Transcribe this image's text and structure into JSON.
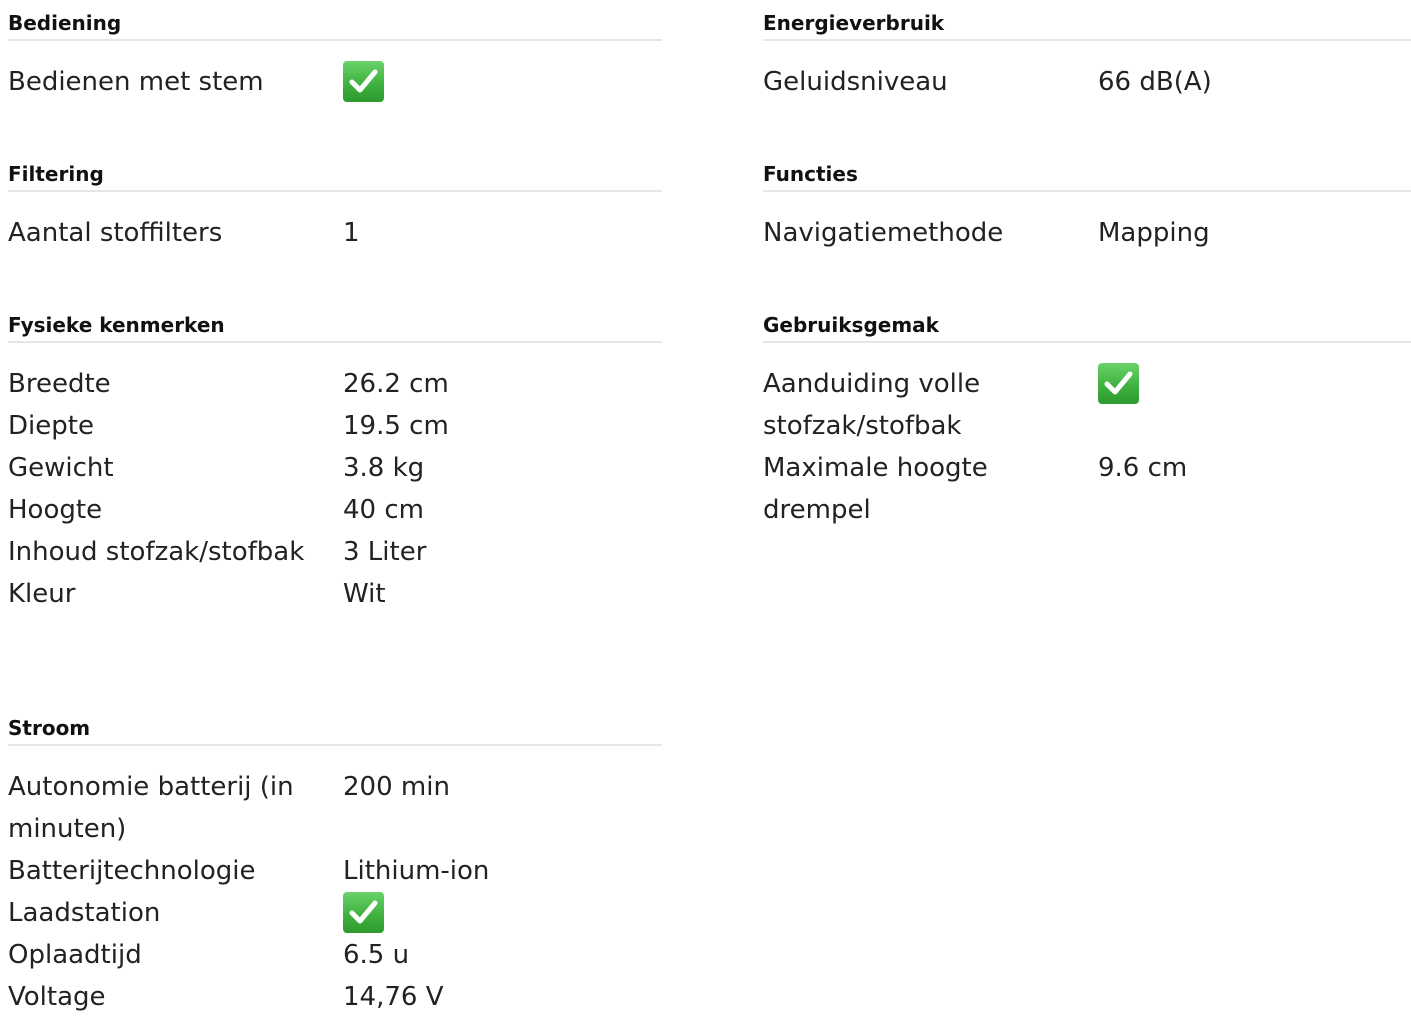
{
  "left": [
    {
      "title": "Bediening",
      "rows": [
        {
          "label": "Bedienen met stem",
          "check": true
        }
      ]
    },
    {
      "title": "Filtering",
      "rows": [
        {
          "label": "Aantal stoffilters",
          "value": "1"
        }
      ]
    },
    {
      "title": "Fysieke kenmerken",
      "rows": [
        {
          "label": "Breedte",
          "value": "26.2 cm"
        },
        {
          "label": "Diepte",
          "value": "19.5 cm"
        },
        {
          "label": "Gewicht",
          "value": "3.8 kg"
        },
        {
          "label": "Hoogte",
          "value": "40 cm"
        },
        {
          "label": "Inhoud stofzak/stofbak",
          "value": "3 Liter"
        },
        {
          "label": "Kleur",
          "value": "Wit"
        }
      ]
    },
    {
      "title": "Stroom",
      "rows": [
        {
          "label": "Autonomie batterij (in minuten)",
          "value": "200 min"
        },
        {
          "label": "Batterijtechnologie",
          "value": "Lithium-ion"
        },
        {
          "label": "Laadstation",
          "check": true
        },
        {
          "label": "Oplaadtijd",
          "value": "6.5 u"
        },
        {
          "label": "Voltage",
          "value": "14,76 V"
        }
      ]
    }
  ],
  "right": [
    {
      "title": "Energieverbruik",
      "rows": [
        {
          "label": "Geluidsniveau",
          "value": "66 dB(A)"
        }
      ]
    },
    {
      "title": "Functies",
      "rows": [
        {
          "label": "Navigatiemethode",
          "value": "Mapping"
        }
      ]
    },
    {
      "title": "Gebruiksgemak",
      "rows": [
        {
          "label": "Aanduiding volle stofzak/stofbak",
          "check": true
        },
        {
          "label": "Maximale hoogte drempel",
          "value": "9.6 cm"
        }
      ]
    }
  ],
  "colors": {
    "check_green": "#3fb23f",
    "divider": "#e6e6e6",
    "text": "#222222"
  },
  "icons": {
    "check": "checkmark-icon"
  }
}
